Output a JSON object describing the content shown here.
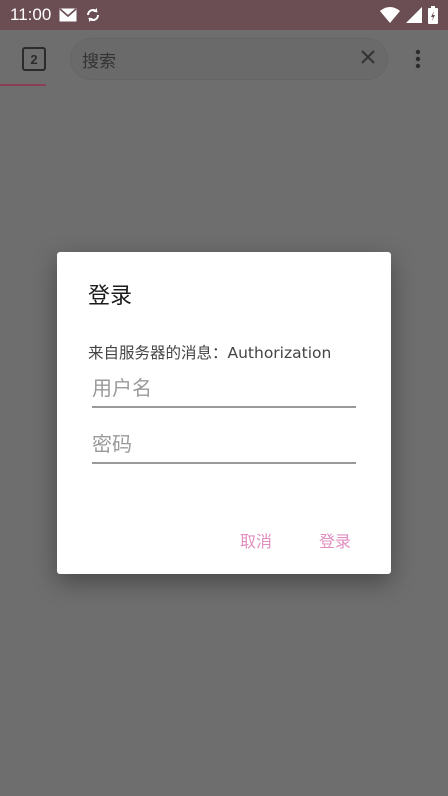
{
  "status_bar": {
    "time": "11:00"
  },
  "toolbar": {
    "tab_count": "2",
    "search_placeholder": "搜索"
  },
  "dialog": {
    "title": "登录",
    "message": "来自服务器的消息：Authorization",
    "username_placeholder": "用户名",
    "password_placeholder": "密码",
    "cancel_label": "取消",
    "login_label": "登录"
  },
  "colors": {
    "status_bar": "#6b4e54",
    "overlay": "#6e6e6e",
    "accent_button": "#e08fc0",
    "progress": "#8a3f55"
  },
  "icons": {
    "status_left": [
      "mail-icon",
      "sync-icon"
    ],
    "status_right": [
      "wifi-icon",
      "signal-icon",
      "battery-icon"
    ],
    "toolbar": [
      "close-icon",
      "more-vert-icon"
    ]
  }
}
